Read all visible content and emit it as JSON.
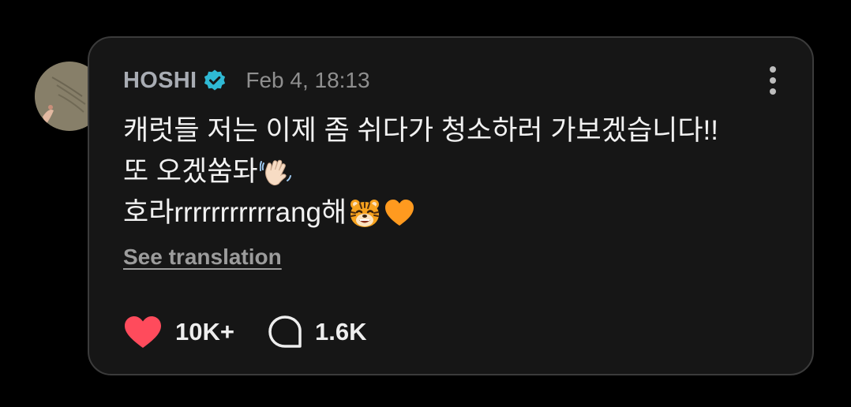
{
  "post": {
    "author": "HOSHI",
    "timestamp": "Feb 4, 18:13",
    "lines": [
      "캐럿들 저는 이제 좀 쉬다가 청소하러 가보겠습니다!!",
      "또 오겠쑴돠",
      "호라rrrrrrrrrrrang해"
    ],
    "emojis": [
      "waving-hand",
      "tiger-face",
      "orange-heart"
    ],
    "see_translation": "See translation",
    "likes": "10K+",
    "comments": "1.6K"
  },
  "colors": {
    "background": "#000000",
    "card": "#161616",
    "card_border": "#3b3b3b",
    "verified": "#2fb9d4",
    "like": "#ff4b5c"
  }
}
